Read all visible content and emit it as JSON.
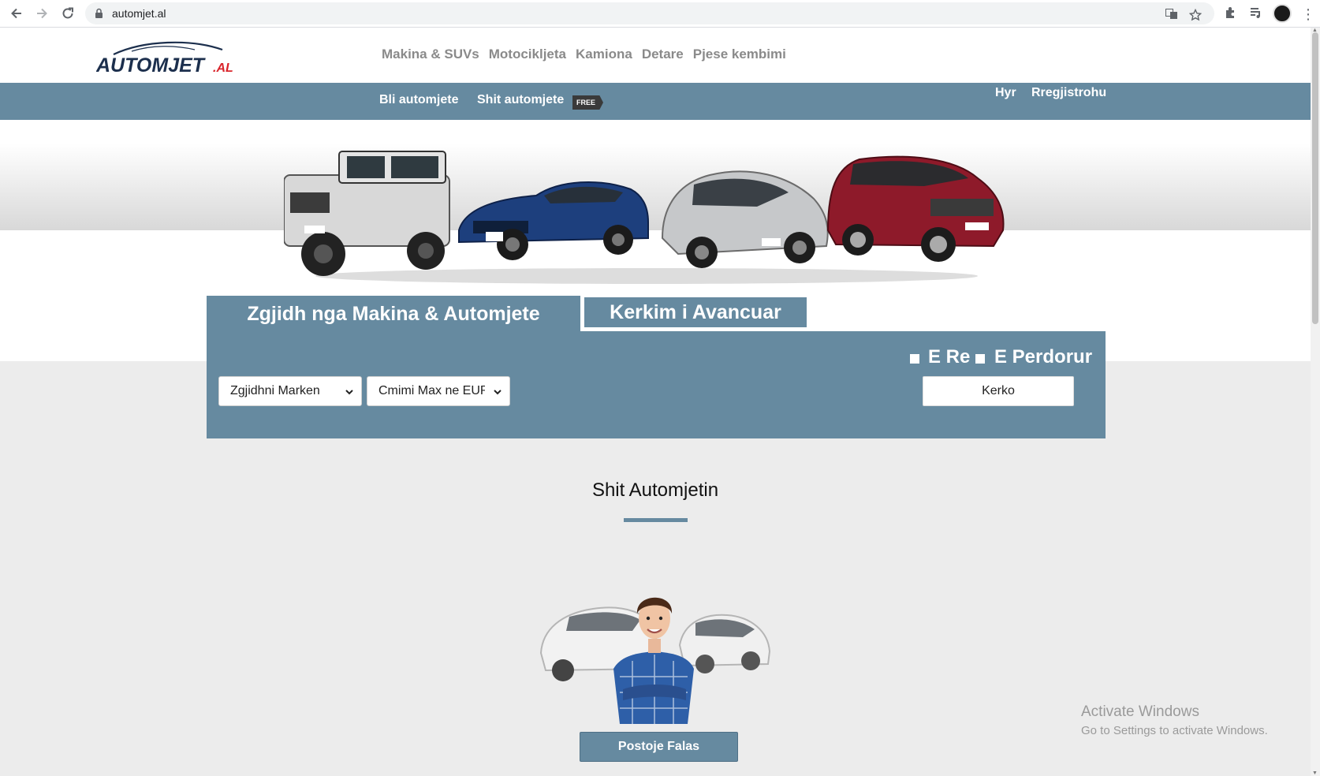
{
  "browser": {
    "url": "automjet.al",
    "icons": [
      "back-icon",
      "forward-icon",
      "reload-icon",
      "lock-icon",
      "translate-icon",
      "bookmark-star-icon",
      "extensions-icon",
      "media-queue-icon",
      "profile-avatar",
      "menu-kebab-icon"
    ]
  },
  "site": {
    "logo_text": "AUTOMJET",
    "logo_suffix": ".AL",
    "top_nav": [
      "Makina & SUVs",
      "Motocikljeta",
      "Kamiona",
      "Detare",
      "Pjese kembimi"
    ],
    "bar": {
      "buy": "Bli automjete",
      "sell": "Shit automjete",
      "free_badge": "FREE",
      "login": "Hyr",
      "register": "Rregjistrohu"
    },
    "colors": {
      "accent": "#668aa0",
      "nav_text": "#8a8a8a"
    }
  },
  "search": {
    "tab_active": "Zgjidh nga Makina & Automjete",
    "tab_advanced": "Kerkim i Avancuar",
    "brand_select": "Zgjidhni Marken",
    "price_select": "Cmimi Max ne EUR",
    "option_new": "E Re",
    "option_used": "E Perdorur",
    "submit": "Kerko"
  },
  "sell": {
    "title": "Shit Automjetin",
    "button": "Postoje Falas"
  },
  "watermark": {
    "title": "Activate Windows",
    "subtitle": "Go to Settings to activate Windows."
  }
}
